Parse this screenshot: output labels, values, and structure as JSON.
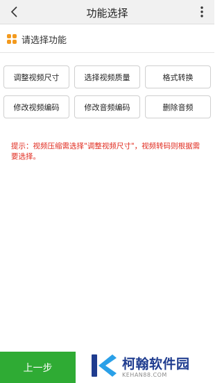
{
  "header": {
    "title": "功能选择"
  },
  "section": {
    "title": "请选择功能"
  },
  "buttons": [
    "调整视频尺寸",
    "选择视频质量",
    "格式转换",
    "修改视频编码",
    "修改音频编码",
    "删除音频"
  ],
  "tip": "提示：视频压缩需选择\"调整视频尺寸\"，视频转码则根据需要选择。",
  "footer": {
    "prev_label": "上一步"
  },
  "watermark": {
    "name": "柯翰软件园",
    "url": "KEHAN88.COM"
  },
  "colors": {
    "accent_orange": "#f39a1e",
    "tip_red": "#e02b1f",
    "primary_green": "#2fab34",
    "watermark_blue": "#1f3c8f"
  },
  "icons": {
    "back": "chevron-left-icon",
    "more": "vertical-dots-icon",
    "section": "grid-icon"
  }
}
